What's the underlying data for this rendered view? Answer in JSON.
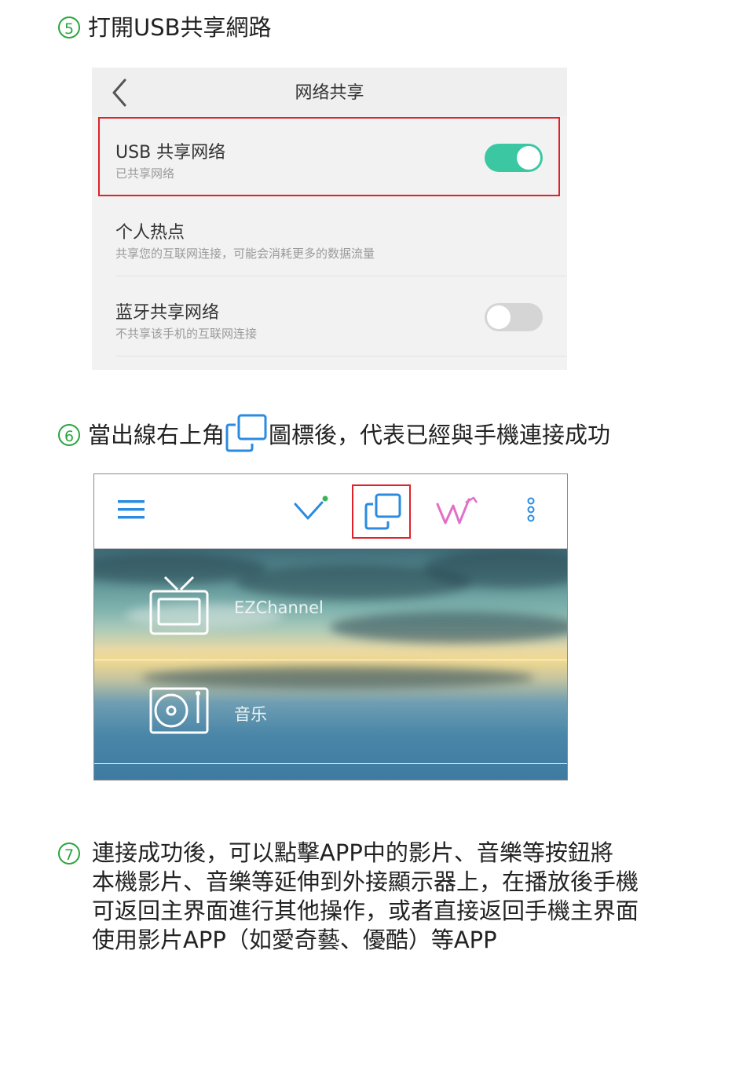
{
  "step5": {
    "number": "5",
    "text": "打開USB共享網路"
  },
  "shot1": {
    "title": "网络共享",
    "usb": {
      "title": "USB 共享网络",
      "subtitle": "已共享网络",
      "toggle": "on"
    },
    "hotspot": {
      "title": "个人热点",
      "subtitle": "共享您的互联网连接，可能会消耗更多的数据流量"
    },
    "bluetooth": {
      "title": "蓝牙共享网络",
      "subtitle": "不共享该手机的互联网连接",
      "toggle": "off"
    },
    "accent_color": "#3cc7a3"
  },
  "step6": {
    "number": "6",
    "text_before": "當出線右上角",
    "text_after": "圖標後，代表已經與手機連接成功",
    "icon": "screen-mirror-icon"
  },
  "shot2": {
    "toolbar_icons": [
      "menu-icon",
      "connected-check-icon",
      "screen-mirror-icon",
      "wifi-display-icon",
      "more-icon"
    ],
    "items": [
      {
        "label": "EZChannel",
        "icon": "tv-icon"
      },
      {
        "label": "音乐",
        "icon": "music-player-icon"
      }
    ]
  },
  "step7": {
    "number": "7",
    "lines": [
      "連接成功後，可以點擊APP中的影片、音樂等按鈕將",
      "本機影片、音樂等延伸到外接顯示器上，在播放後手機",
      "可返回主界面進行其他操作，或者直接返回手機主界面",
      "使用影片APP（如愛奇藝、優酷）等APP"
    ]
  },
  "colors": {
    "step_number": "#2aa53c",
    "highlight": "#e0202a",
    "icon_blue": "#2a8be0"
  }
}
